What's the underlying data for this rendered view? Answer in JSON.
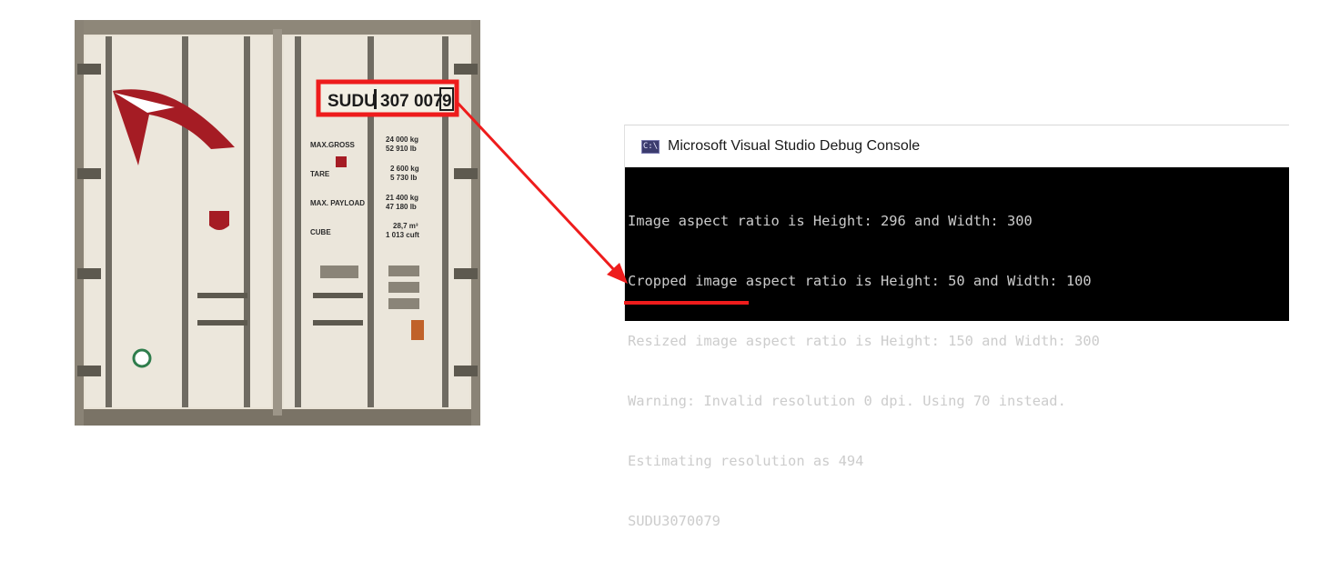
{
  "container": {
    "plate": {
      "prefix": "SUDU",
      "number": "307 007",
      "check_digit": "9"
    },
    "specs": [
      {
        "label": "MAX.GROSS",
        "line1": "24 000 kg",
        "line2": "52 910 lb"
      },
      {
        "label": "TARE",
        "line1": "2 600 kg",
        "line2": "5 730 lb"
      },
      {
        "label": "MAX. PAYLOAD",
        "line1": "21 400 kg",
        "line2": "47 180 lb"
      },
      {
        "label": "CUBE",
        "line1": "28,7 m³",
        "line2": "1 013 cuft"
      }
    ]
  },
  "console": {
    "title": "Microsoft Visual Studio Debug Console",
    "icon": "console-app-icon",
    "icon_text": "C:\\",
    "lines": [
      "Image aspect ratio is Height: 296 and Width: 300",
      "Cropped image aspect ratio is Height: 50 and Width: 100",
      "Resized image aspect ratio is Height: 150 and Width: 300",
      "Warning: Invalid resolution 0 dpi. Using 70 instead.",
      "Estimating resolution as 494",
      "SUDU3070079"
    ]
  },
  "colors": {
    "highlight": "#ee1c1c",
    "console_bg": "#000000",
    "console_text": "#cccccc",
    "logo_red": "#a51c24"
  }
}
